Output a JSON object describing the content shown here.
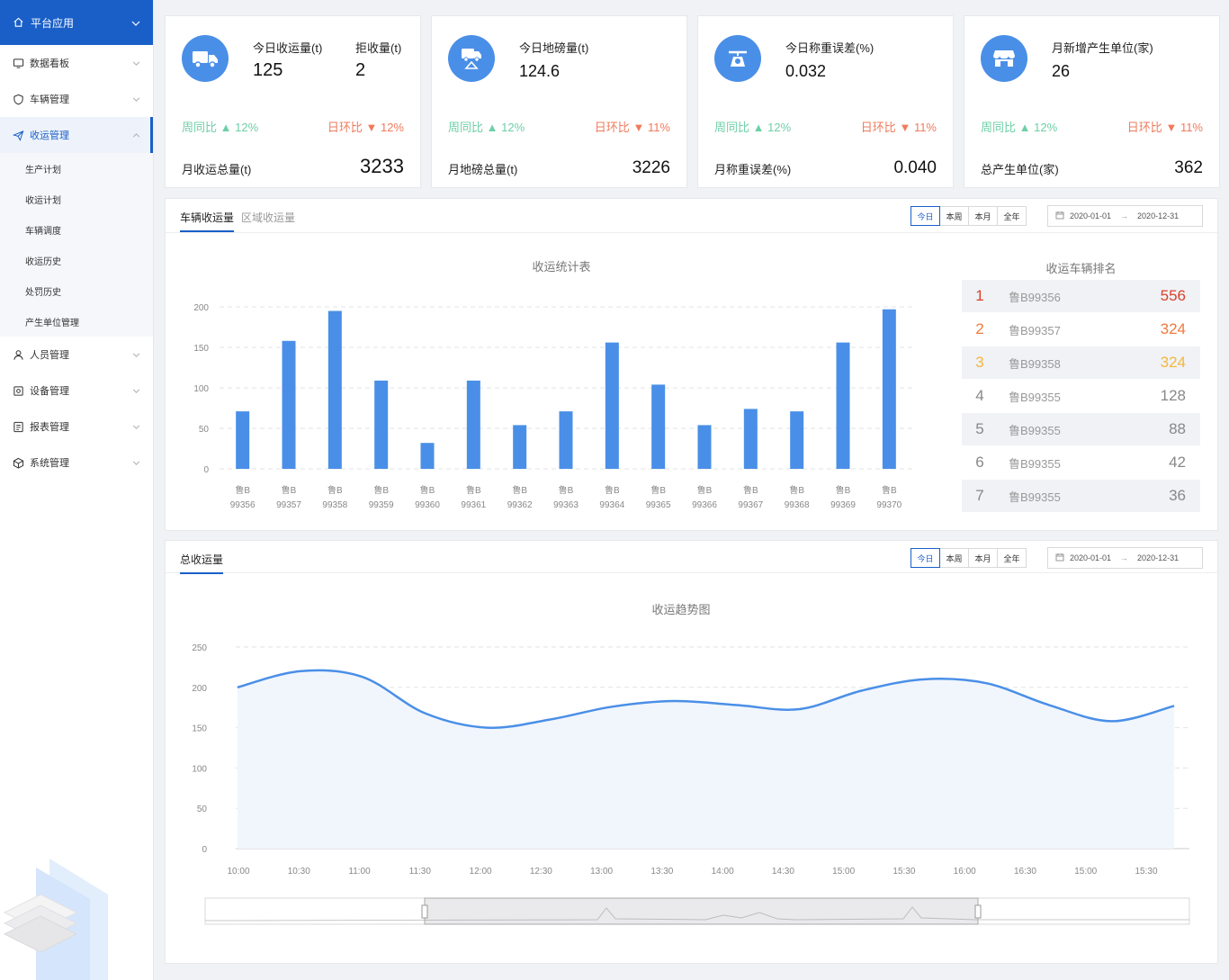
{
  "sidebar": {
    "top": {
      "label": "平台应用"
    },
    "items": [
      {
        "label": "数据看板"
      },
      {
        "label": "车辆管理"
      },
      {
        "label": "收运管理"
      },
      {
        "label": "人员管理"
      },
      {
        "label": "设备管理"
      },
      {
        "label": "报表管理"
      },
      {
        "label": "系统管理"
      }
    ],
    "sub_items": [
      {
        "label": "生产计划"
      },
      {
        "label": "收运计划"
      },
      {
        "label": "车辆调度"
      },
      {
        "label": "收运历史"
      },
      {
        "label": "处罚历史"
      },
      {
        "label": "产生单位管理"
      }
    ]
  },
  "cards": [
    {
      "label1": "今日收运量(t)",
      "value1": "125",
      "label2": "拒收量(t)",
      "value2": "2",
      "week_label": "周同比",
      "week_value": "12%",
      "day_label": "日环比",
      "day_value": "12%",
      "month_label": "月收运总量(t)",
      "month_value": "3233"
    },
    {
      "label1": "今日地磅量(t)",
      "value1": "124.6",
      "week_label": "周同比",
      "week_value": "12%",
      "day_label": "日环比",
      "day_value": "11%",
      "month_label": "月地磅总量(t)",
      "month_value": "3226"
    },
    {
      "label1": "今日称重误差(%)",
      "value1": "0.032",
      "week_label": "周同比",
      "week_value": "12%",
      "day_label": "日环比",
      "day_value": "11%",
      "month_label": "月称重误差(%)",
      "month_value": "0.040"
    },
    {
      "label1": "月新增产生单位(家)",
      "value1": "26",
      "week_label": "周同比",
      "week_value": "12%",
      "day_label": "日环比",
      "day_value": "11%",
      "month_label": "总产生单位(家)",
      "month_value": "362"
    }
  ],
  "panel1": {
    "tabs": [
      {
        "label": "车辆收运量"
      },
      {
        "label": "区域收运量"
      }
    ],
    "periods": [
      "今日",
      "本周",
      "本月",
      "全年"
    ],
    "date_start": "2020-01-01",
    "date_end": "2020-12-31",
    "rank_title": "收运车辆排名",
    "ranking": [
      {
        "rank": "1",
        "plate": "鲁B99356",
        "value": "556",
        "color": "#d9412b"
      },
      {
        "rank": "2",
        "plate": "鲁B99357",
        "value": "324",
        "color": "#f07a3c"
      },
      {
        "rank": "3",
        "plate": "鲁B99358",
        "value": "324",
        "color": "#f5b63d"
      },
      {
        "rank": "4",
        "plate": "鲁B99355",
        "value": "128",
        "color": "#888888"
      },
      {
        "rank": "5",
        "plate": "鲁B99355",
        "value": "88",
        "color": "#888888"
      },
      {
        "rank": "6",
        "plate": "鲁B99355",
        "value": "42",
        "color": "#888888"
      },
      {
        "rank": "7",
        "plate": "鲁B99355",
        "value": "36",
        "color": "#888888"
      }
    ]
  },
  "panel2": {
    "tabs": [
      {
        "label": "总收运量"
      }
    ],
    "periods": [
      "今日",
      "本周",
      "本月",
      "全年"
    ],
    "date_start": "2020-01-01",
    "date_end": "2020-12-31"
  },
  "colors": {
    "accent": "#1a5fc8",
    "bar": "#4a8fe7",
    "up": "#6fcfa8",
    "down": "#f07a5c"
  },
  "chart_data": [
    {
      "type": "bar",
      "title": "收运统计表",
      "categories": [
        "鲁B 99356",
        "鲁B 99357",
        "鲁B 99358",
        "鲁B 99359",
        "鲁B 99360",
        "鲁B 99361",
        "鲁B 99362",
        "鲁B 99363",
        "鲁B 99364",
        "鲁B 99365",
        "鲁B 99366",
        "鲁B 99367",
        "鲁B 99368",
        "鲁B 99369",
        "鲁B 99370"
      ],
      "category_lines": [
        [
          "鲁B",
          "99356"
        ],
        [
          "鲁B",
          "99357"
        ],
        [
          "鲁B",
          "99358"
        ],
        [
          "鲁B",
          "99359"
        ],
        [
          "鲁B",
          "99360"
        ],
        [
          "鲁B",
          "99361"
        ],
        [
          "鲁B",
          "99362"
        ],
        [
          "鲁B",
          "99363"
        ],
        [
          "鲁B",
          "99364"
        ],
        [
          "鲁B",
          "99365"
        ],
        [
          "鲁B",
          "99366"
        ],
        [
          "鲁B",
          "99367"
        ],
        [
          "鲁B",
          "99368"
        ],
        [
          "鲁B",
          "99369"
        ],
        [
          "鲁B",
          "99370"
        ]
      ],
      "values": [
        71,
        158,
        195,
        109,
        32,
        109,
        54,
        71,
        156,
        104,
        54,
        74,
        71,
        156,
        197
      ],
      "ylim": [
        0,
        200
      ],
      "yticks": [
        "0",
        "50",
        "100",
        "150",
        "200"
      ],
      "grid": true
    },
    {
      "type": "area",
      "title": "收运趋势图",
      "x": [
        "10:00",
        "10:30",
        "11:00",
        "11:30",
        "12:00",
        "12:30",
        "13:00",
        "13:30",
        "14:00",
        "14:30",
        "15:00",
        "15:30",
        "16:00",
        "16:30",
        "15:00",
        "15:30"
      ],
      "anchor_values": [
        200,
        220,
        213,
        168,
        150,
        160,
        176,
        183,
        178,
        173,
        196,
        210,
        205,
        178,
        158,
        177
      ],
      "ylim": [
        0,
        250
      ],
      "yticks": [
        "0",
        "50",
        "100",
        "150",
        "200",
        "250"
      ],
      "grid": true
    }
  ]
}
